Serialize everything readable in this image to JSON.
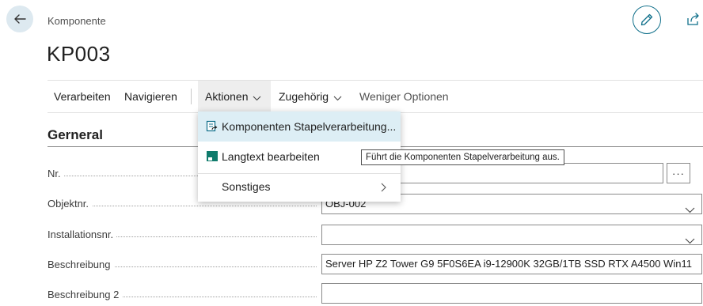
{
  "header": {
    "entity_caption": "Komponente",
    "record_title": "KP003"
  },
  "action_bar": {
    "items": [
      {
        "label": "Verarbeiten"
      },
      {
        "label": "Navigieren"
      },
      {
        "label": "Aktionen"
      },
      {
        "label": "Zugehörig"
      },
      {
        "label": "Weniger Optionen"
      }
    ]
  },
  "menu": {
    "items": [
      {
        "label": "Komponenten Stapelverarbeitung...",
        "icon": "batch-process-icon"
      },
      {
        "label": "Langtext bearbeiten",
        "icon": "text-edit-icon"
      },
      {
        "label": "Sonstiges",
        "icon": "chevron-right-icon"
      }
    ]
  },
  "tooltip": {
    "text": "Führt die Komponenten Stapelverarbeitung aus."
  },
  "section": {
    "title": "Gerneral"
  },
  "fields": [
    {
      "label": "Nr.",
      "value": "",
      "assist_label": "···"
    },
    {
      "label": "Objektnr.",
      "value": "OBJ-002"
    },
    {
      "label": "Installationsnr.",
      "value": ""
    },
    {
      "label": "Beschreibung",
      "value": "Server HP Z2 Tower G9 5F0S6EA i9-12900K 32GB/1TB SSD RTX A4500 Win11"
    },
    {
      "label": "Beschreibung 2",
      "value": ""
    }
  ],
  "colors": {
    "accent": "#0f6f8a",
    "highlight": "#ddeef5",
    "back_button_bg": "#dde9f0"
  }
}
